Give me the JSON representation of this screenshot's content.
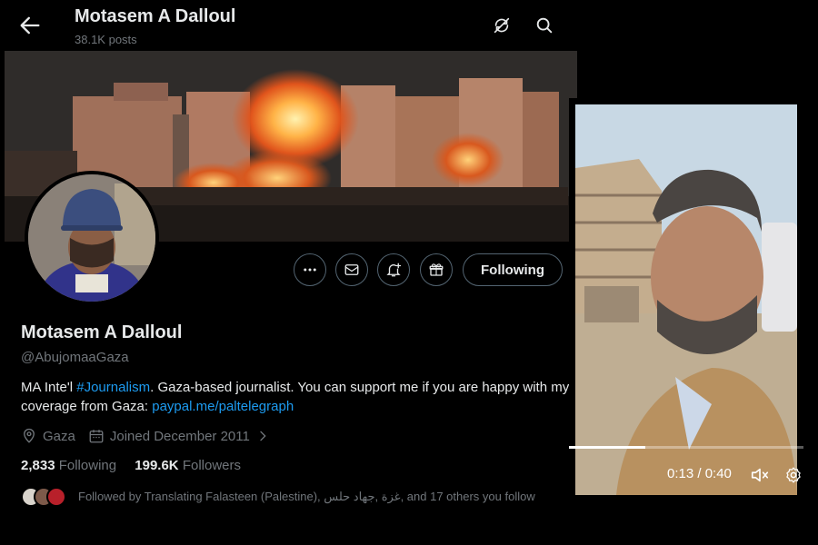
{
  "header": {
    "name": "Motasem A Dalloul",
    "posts": "38.1K posts"
  },
  "profile": {
    "display_name": "Motasem A Dalloul",
    "handle": "@AbujomaaGaza",
    "actions": {
      "following_label": "Following"
    },
    "bio": {
      "part1": "MA Inte'l ",
      "hashtag": "#Journalism",
      "part2": ". Gaza-based journalist. You can support me if you are happy with my coverage from Gaza: ",
      "link": "paypal.me/paltelegraph"
    },
    "location": "Gaza",
    "joined": "Joined December 2011",
    "stats": {
      "following_count": "2,833",
      "following_label": "Following",
      "followers_count": "199.6K",
      "followers_label": "Followers"
    },
    "followed_by": "Followed by Translating Falasteen (Palestine), غزة ,جهاد حلس, and 17 others you follow"
  },
  "video": {
    "time": "0:13 / 0:40",
    "progress": 0.325
  },
  "icons": {
    "back": "arrow-left-icon",
    "no_retweets": "retweet-off-icon",
    "search": "search-icon",
    "more": "more-icon",
    "message": "envelope-icon",
    "notify": "bell-plus-icon",
    "gift": "gift-icon",
    "location": "location-pin-icon",
    "calendar": "calendar-icon",
    "mute": "speaker-muted-icon",
    "settings": "gear-icon"
  },
  "colors": {
    "background": "#000000",
    "text": "#e7e9ea",
    "muted": "#71767b",
    "link": "#1d9bf0",
    "border": "#536471"
  }
}
